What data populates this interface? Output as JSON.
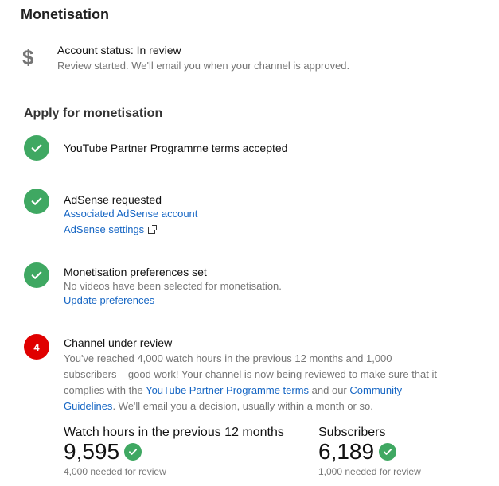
{
  "page": {
    "title": "Monetisation"
  },
  "account_status": {
    "icon": "dollar-icon",
    "title": "Account status: In review",
    "description": "Review started. We'll email you when your channel is approved."
  },
  "apply": {
    "heading": "Apply for monetisation",
    "steps": [
      {
        "status": "done",
        "title": "YouTube Partner Programme terms accepted"
      },
      {
        "status": "done",
        "title": "AdSense requested",
        "links": [
          "Associated AdSense account",
          "AdSense settings"
        ]
      },
      {
        "status": "done",
        "title": "Monetisation preferences set",
        "description": "No videos have been selected for monetisation.",
        "links": [
          "Update preferences"
        ]
      },
      {
        "status": "in-progress",
        "number": "4",
        "title": "Channel under review",
        "desc_part1": "You've reached 4,000 watch hours in the previous 12 months and 1,000 subscribers – good work! Your channel is now being reviewed to make sure that it complies with the ",
        "desc_link1": "YouTube Partner Programme terms",
        "desc_part2": " and our ",
        "desc_link2": "Community Guidelines",
        "desc_part3": ". We'll email you a decision, usually within a month or so."
      }
    ]
  },
  "stats": {
    "watch_hours": {
      "label": "Watch hours in the previous 12 months",
      "value": "9,595",
      "note": "4,000 needed for review"
    },
    "subscribers": {
      "label": "Subscribers",
      "value": "6,189",
      "note": "1,000 needed for review"
    }
  },
  "colors": {
    "success": "#3fa862",
    "alert": "#e00000",
    "link": "#1666c4"
  }
}
